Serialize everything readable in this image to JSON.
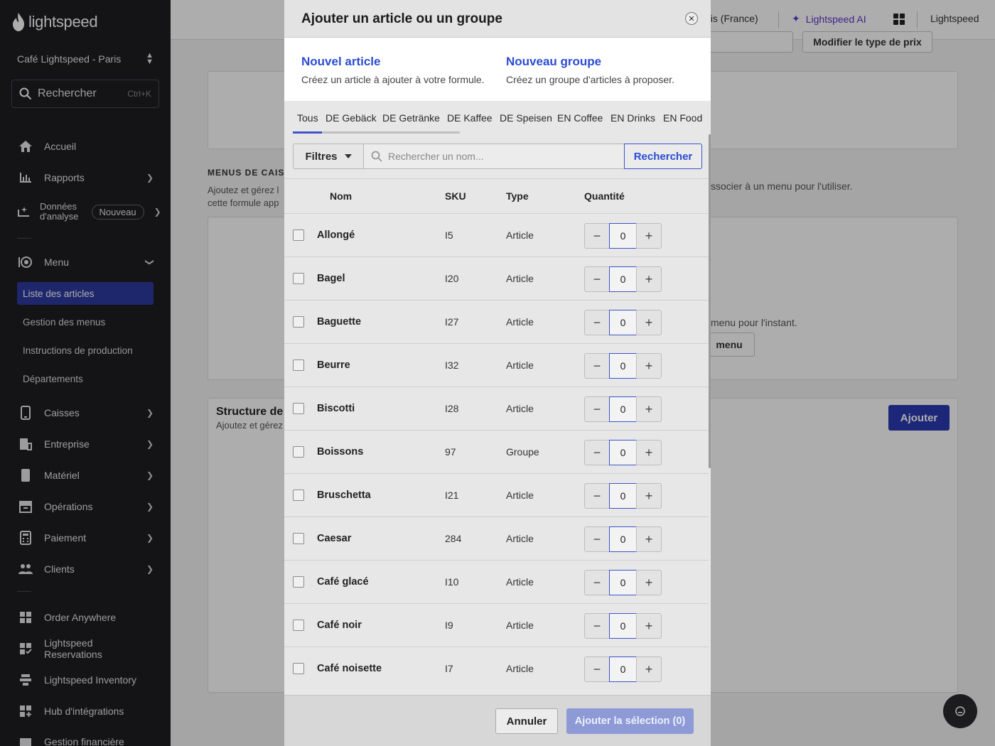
{
  "sidebar": {
    "logo_text": "lightspeed",
    "location": "Café Lightspeed - Paris",
    "search_label": "Rechercher",
    "search_shortcut": "Ctrl+K",
    "nav": {
      "accueil": "Accueil",
      "rapports": "Rapports",
      "donnees_line1": "Données",
      "donnees_line2": "d'analyse",
      "donnees_badge": "Nouveau",
      "menu": "Menu",
      "caisses": "Caisses",
      "entreprise": "Entreprise",
      "materiel": "Matériel",
      "operations": "Opérations",
      "paiement": "Paiement",
      "clients": "Clients",
      "order_anywhere": "Order Anywhere",
      "reservations": "Lightspeed Reservations",
      "inventory": "Lightspeed Inventory",
      "hub": "Hub d'intégrations",
      "gestion_financiere": "Gestion financière"
    },
    "submenu": {
      "liste_articles": "Liste des articles",
      "gestion_menus": "Gestion des menus",
      "instructions": "Instructions de production",
      "departements": "Départements"
    }
  },
  "topbar": {
    "language_fragment": "ais (France)",
    "ai_label": "Lightspeed AI",
    "account": "Lightspeed"
  },
  "background": {
    "price_type_button": "Modifier le type de prix",
    "menus_heading_fragment": "MENUS DE CAIS",
    "menus_desc_line1": "Ajoutez et gérez l",
    "menus_desc_line2": "cette formule app",
    "associate_text": "ssocier à un menu pour l'utiliser.",
    "no_menu_text": "menu pour l'instant.",
    "menu_button_fragment": "menu",
    "structure_title_fragment": "Structure de l",
    "structure_desc_fragment": "Ajoutez et gérez",
    "add_button": "Ajouter"
  },
  "modal": {
    "title": "Ajouter un article ou un groupe",
    "new_article": {
      "label": "Nouvel article",
      "desc": "Créez un article à ajouter à votre formule."
    },
    "new_group": {
      "label": "Nouveau groupe",
      "desc": "Créez un groupe d'articles à proposer."
    },
    "tabs": [
      "Tous",
      "DE Gebäck",
      "DE Getränke",
      "DE Kaffee",
      "DE Speisen",
      "EN Coffee",
      "EN Drinks",
      "EN Food"
    ],
    "filters_label": "Filtres",
    "search_placeholder": "Rechercher un nom...",
    "search_button": "Rechercher",
    "columns": {
      "name": "Nom",
      "sku": "SKU",
      "type": "Type",
      "quantity": "Quantité"
    },
    "rows": [
      {
        "name": "Allongé",
        "sku": "I5",
        "type": "Article",
        "qty": "0"
      },
      {
        "name": "Bagel",
        "sku": "I20",
        "type": "Article",
        "qty": "0"
      },
      {
        "name": "Baguette",
        "sku": "I27",
        "type": "Article",
        "qty": "0"
      },
      {
        "name": "Beurre",
        "sku": "I32",
        "type": "Article",
        "qty": "0"
      },
      {
        "name": "Biscotti",
        "sku": "I28",
        "type": "Article",
        "qty": "0"
      },
      {
        "name": "Boissons",
        "sku": "97",
        "type": "Groupe",
        "qty": "0"
      },
      {
        "name": "Bruschetta",
        "sku": "I21",
        "type": "Article",
        "qty": "0"
      },
      {
        "name": "Caesar",
        "sku": "284",
        "type": "Article",
        "qty": "0"
      },
      {
        "name": "Café glacé",
        "sku": "I10",
        "type": "Article",
        "qty": "0"
      },
      {
        "name": "Café noir",
        "sku": "I9",
        "type": "Article",
        "qty": "0"
      },
      {
        "name": "Café noisette",
        "sku": "I7",
        "type": "Article",
        "qty": "0"
      }
    ],
    "cancel_button": "Annuler",
    "add_selection_button": "Ajouter la sélection (0)"
  },
  "icons": {
    "logo": "flame-icon",
    "search": "search-icon",
    "home": "home-icon",
    "reports": "bar-chart-icon",
    "analytics": "sparkle-chart-icon",
    "menu": "dish-icon",
    "registers": "tablet-icon",
    "company": "building-icon",
    "hardware": "device-icon",
    "operations": "archive-icon",
    "payment": "calculator-icon",
    "customers": "people-icon",
    "apps": "grid-icon",
    "close": "close-icon",
    "minus": "minus-icon",
    "plus": "plus-icon",
    "chat": "chat-icon"
  },
  "colors": {
    "accent": "#2b4bd3",
    "sidebar_bg": "#1e1e22",
    "active_item": "#2f3aa0",
    "ai": "#5a35c7"
  }
}
